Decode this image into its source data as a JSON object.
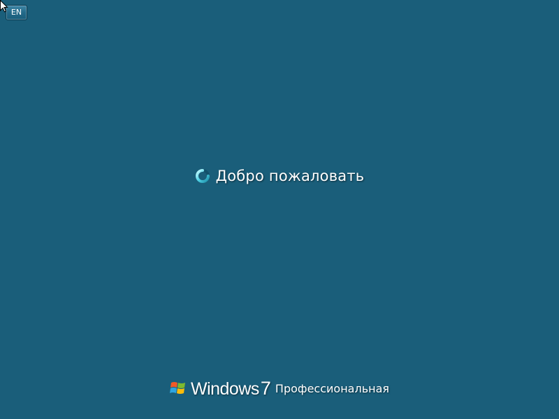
{
  "language_button": {
    "label": "EN"
  },
  "welcome": {
    "text": "Добро пожаловать",
    "spinner_icon": "loading-spinner-icon"
  },
  "branding": {
    "logo_icon": "windows-flag-icon",
    "product_name": "Windows",
    "version": "7",
    "edition": "Профессиональная"
  },
  "colors": {
    "background": "#1a5e7a",
    "text": "#ffffff",
    "spinner": "#6ee3f0"
  }
}
